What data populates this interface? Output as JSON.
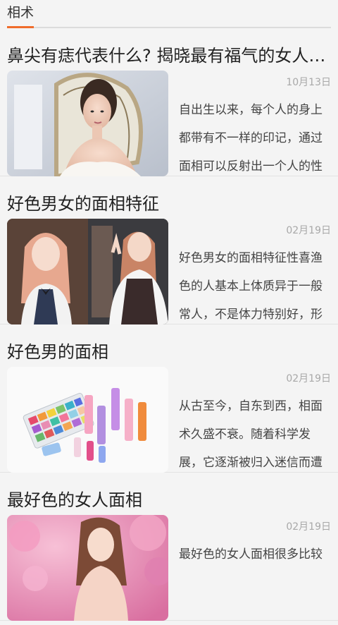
{
  "header": {
    "title": "相术",
    "accent_color": "#ef6c2b"
  },
  "articles": [
    {
      "title": "鼻尖有痣代表什么? 揭晓最有福气的女人面相",
      "date": "10月13日",
      "summary": "自出生以来，每个人的身上都带有不一样的印记，通过面相可以反射出一个人的性",
      "image": "woman-on-white-ornate-chair"
    },
    {
      "title": "好色男女的面相特征",
      "date": "02月19日",
      "summary": "好色男女的面相特征性喜渔色的人基本上体质异于一般常人，不是体力特别好，形",
      "image": "two-women-pink-hair"
    },
    {
      "title": "好色男的面相",
      "date": "02月19日",
      "summary": "从古至今，自东到西，相面术久盛不衰。随着科学发展，它逐渐被归入迷信而遭",
      "image": "cosmetics-palette-and-lipsticks"
    },
    {
      "title": "最好色的女人面相",
      "date": "02月19日",
      "summary": "最好色的女人面相很多比较",
      "image": "woman-among-pink-flowers"
    }
  ]
}
